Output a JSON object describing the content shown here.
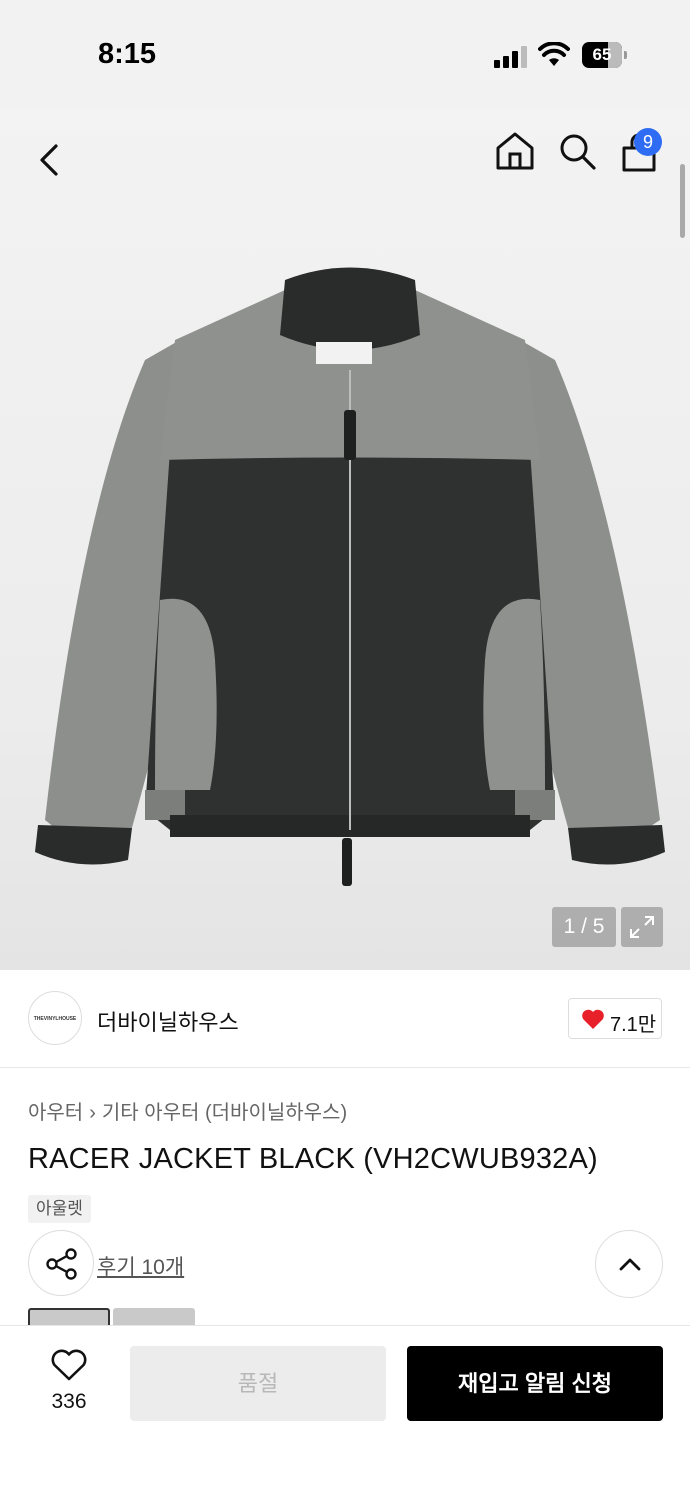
{
  "status_bar": {
    "time": "8:15",
    "battery": "65"
  },
  "header": {
    "cart_count": "9"
  },
  "gallery": {
    "page_indicator": "1 / 5",
    "current_page": 1,
    "total_pages": 5
  },
  "brand": {
    "logo_text": "THEVINYLHOUSE",
    "name": "더바이닐하우스",
    "likes": "7.1만"
  },
  "product": {
    "breadcrumb": [
      "아우터",
      "기타 아우터 (더바이닐하우스)"
    ],
    "title": "RACER JACKET BLACK (VH2CWUB932A)",
    "tag": "아울렛",
    "review_link": "후기 10개"
  },
  "bottom_bar": {
    "wish_count": "336",
    "soldout_label": "품절",
    "restock_label": "재입고 알림 신청"
  },
  "colors": {
    "accent_badge": "#2e6cf4",
    "heart": "#e8202a",
    "primary_button": "#000000",
    "disabled_button": "#ececec"
  }
}
